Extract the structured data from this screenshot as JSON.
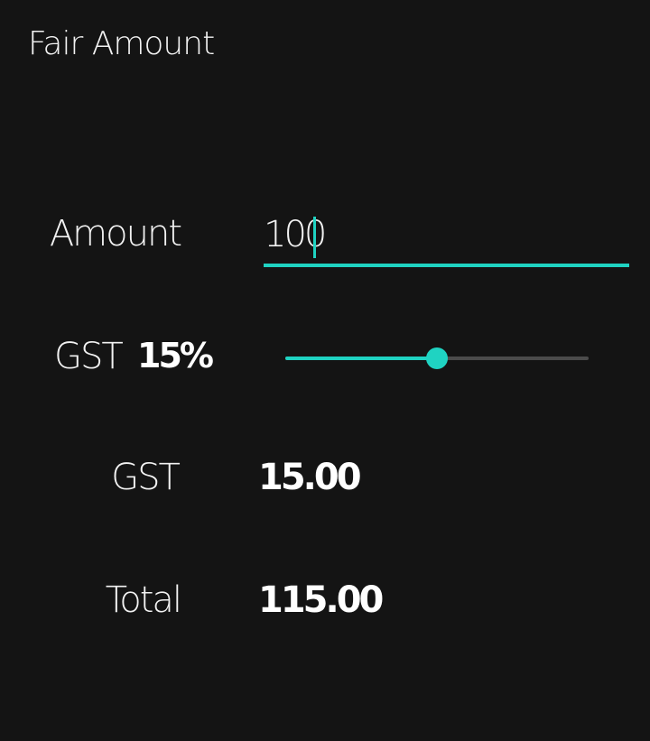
{
  "app": {
    "title": "Fair Amount"
  },
  "form": {
    "amount_label": "Amount",
    "amount_value": "100",
    "gst_rate_label": "GST",
    "gst_rate_value": "15%",
    "gst_rate_percent": 15,
    "slider_fraction": 0.5
  },
  "results": {
    "gst_label": "GST",
    "gst_value": "15.00",
    "total_label": "Total",
    "total_value": "115.00"
  },
  "colors": {
    "background": "#141414",
    "accent": "#1fd3c2",
    "text": "#ffffff",
    "track_inactive": "#4b4b4b"
  }
}
